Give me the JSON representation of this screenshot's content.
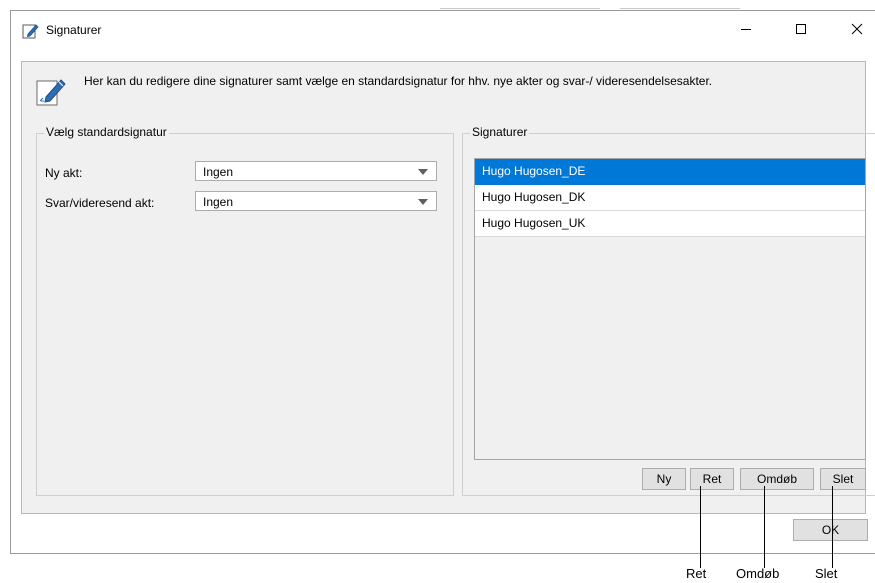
{
  "window": {
    "title": "Signaturer",
    "minimize_glyph": "—",
    "maximize_glyph": "☐",
    "close_glyph": "✕"
  },
  "header": {
    "icon": "edit-signature-icon",
    "description": "Her kan du redigere dine signaturer samt vælge en standardsignatur for hhv. nye akter og svar-/ videresendelsesakter."
  },
  "default_group": {
    "title": "Vælg standardsignatur",
    "new_label": "Ny akt:",
    "new_value": "Ingen",
    "reply_label": "Svar/videresend akt:",
    "reply_value": "Ingen"
  },
  "signatures_group": {
    "title": "Signaturer",
    "items": [
      "Hugo Hugosen_DE",
      "Hugo Hugosen_DK",
      "Hugo Hugosen_UK"
    ],
    "selected_index": 0,
    "buttons": {
      "new": "Ny",
      "edit": "Ret",
      "rename": "Omdøb",
      "delete": "Slet"
    }
  },
  "footer": {
    "ok": "OK"
  },
  "callouts": {
    "edit": "Ret",
    "rename": "Omdøb",
    "delete": "Slet"
  },
  "colors": {
    "selection": "#0078d7",
    "client_bg": "#f0f0f0"
  }
}
